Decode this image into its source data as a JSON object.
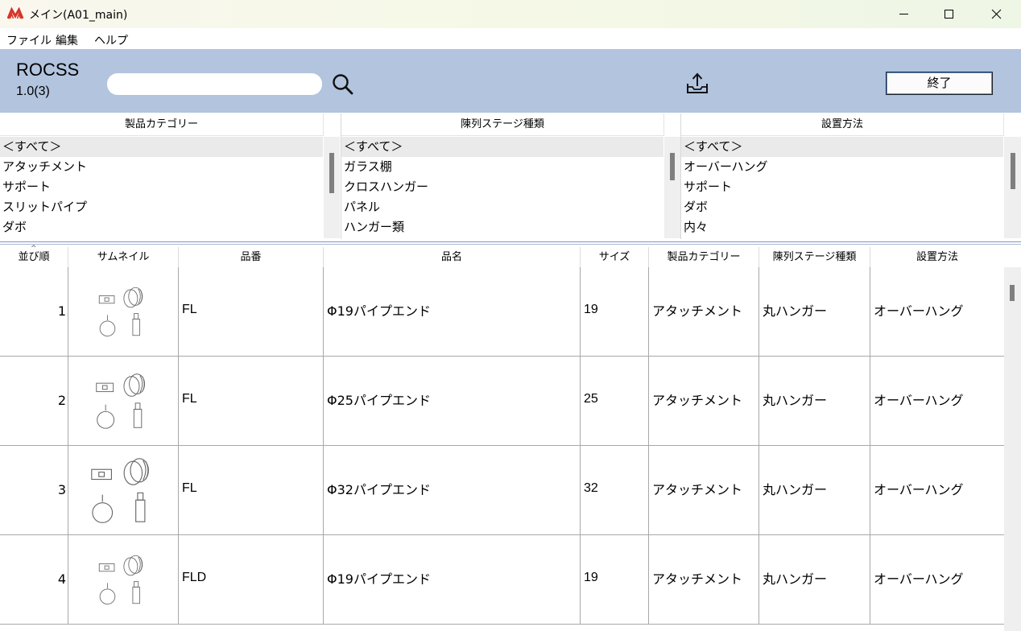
{
  "window": {
    "title": "メイン(A01_main)"
  },
  "menu": [
    "ファイル",
    "編集",
    "ヘルプ"
  ],
  "toolbar": {
    "app_name": "ROCSS",
    "version": "1.0(3)",
    "search_value": "",
    "exit_label": "終了"
  },
  "filters": [
    {
      "header": "製品カテゴリー",
      "items": [
        "＜すべて＞",
        "アタッチメント",
        "サポート",
        "スリットパイプ",
        "ダボ"
      ]
    },
    {
      "header": "陳列ステージ種類",
      "items": [
        "＜すべて＞",
        "ガラス棚",
        "クロスハンガー",
        "パネル",
        "ハンガー類"
      ]
    },
    {
      "header": "設置方法",
      "items": [
        "＜すべて＞",
        "オーバーハング",
        "サポート",
        "ダボ",
        "内々"
      ]
    }
  ],
  "grid": {
    "columns": [
      "並び順",
      "サムネイル",
      "品番",
      "品名",
      "サイズ",
      "製品カテゴリー",
      "陳列ステージ種類",
      "設置方法"
    ],
    "rows": [
      {
        "order": "1",
        "part_no": "FL",
        "name": "Φ19パイプエンド",
        "size": "19",
        "category": "アタッチメント",
        "stage": "丸ハンガー",
        "method": "オーバーハング"
      },
      {
        "order": "2",
        "part_no": "FL",
        "name": "Φ25パイプエンド",
        "size": "25",
        "category": "アタッチメント",
        "stage": "丸ハンガー",
        "method": "オーバーハング"
      },
      {
        "order": "3",
        "part_no": "FL",
        "name": "Φ32パイプエンド",
        "size": "32",
        "category": "アタッチメント",
        "stage": "丸ハンガー",
        "method": "オーバーハング"
      },
      {
        "order": "4",
        "part_no": "FLD",
        "name": "Φ19パイプエンド",
        "size": "19",
        "category": "アタッチメント",
        "stage": "丸ハンガー",
        "method": "オーバーハング"
      }
    ]
  },
  "colors": {
    "toolbar_bg": "#b2c4de",
    "logo": "#d8332a",
    "splitter": "#7d95c0"
  }
}
